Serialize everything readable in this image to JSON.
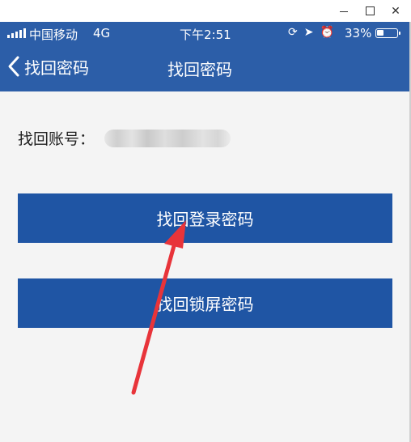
{
  "status_bar": {
    "carrier": "中国移动",
    "network": "4G",
    "time": "下午2:51",
    "battery_percent": "33%",
    "battery_level": 0.33,
    "icons": [
      "orientation-lock-icon",
      "location-icon",
      "alarm-icon"
    ]
  },
  "nav": {
    "back_label": "找回密码",
    "title": "找回密码"
  },
  "account": {
    "label": "找回账号："
  },
  "buttons": {
    "login_password": "找回登录密码",
    "lock_password": "找回锁屏密码"
  },
  "colors": {
    "header": "#2c5ea8",
    "button": "#1f55a4",
    "background": "#f4f4f4",
    "annotation_arrow": "#e8343a"
  }
}
